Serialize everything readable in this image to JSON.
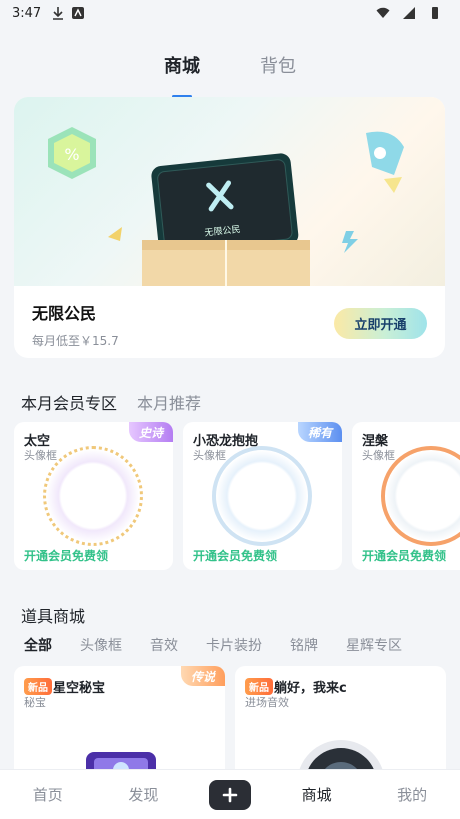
{
  "status": {
    "time": "3:47"
  },
  "top_tabs": [
    {
      "label": "商城",
      "active": true
    },
    {
      "label": "背包",
      "active": false
    }
  ],
  "hero": {
    "card_brand": "无限公民",
    "title": "无限公民",
    "subtitle": "每月低至￥15.7",
    "button": "立即开通"
  },
  "section_tabs": [
    {
      "label": "本月会员专区",
      "active": true
    },
    {
      "label": "本月推荐",
      "active": false
    }
  ],
  "vip_items": [
    {
      "name": "太空",
      "type": "头像框",
      "rarity": "史诗",
      "cta": "开通会员免费领"
    },
    {
      "name": "小恐龙抱抱",
      "type": "头像框",
      "rarity": "稀有",
      "cta": "开通会员免费领"
    },
    {
      "name": "涅槃",
      "type": "头像框",
      "rarity": "",
      "cta": "开通会员免费领"
    }
  ],
  "tools": {
    "title": "道具商城",
    "categories": [
      {
        "label": "全部",
        "active": true
      },
      {
        "label": "头像框",
        "active": false
      },
      {
        "label": "音效",
        "active": false
      },
      {
        "label": "卡片装扮",
        "active": false
      },
      {
        "label": "铭牌",
        "active": false
      },
      {
        "label": "星辉专区",
        "active": false
      }
    ],
    "items": [
      {
        "badge": "新品",
        "name": "星空秘宝",
        "type": "秘宝",
        "rarity": "传说"
      },
      {
        "badge": "新品",
        "name": "躺好，我来c",
        "type": "进场音效",
        "rarity": ""
      }
    ]
  },
  "bottom_nav": [
    {
      "label": "首页",
      "active": false
    },
    {
      "label": "发现",
      "active": false
    },
    {
      "label": "商城",
      "active": true
    },
    {
      "label": "我的",
      "active": false
    }
  ],
  "colors": {
    "accent": "#2f80ed",
    "free_green": "#33c28a"
  }
}
